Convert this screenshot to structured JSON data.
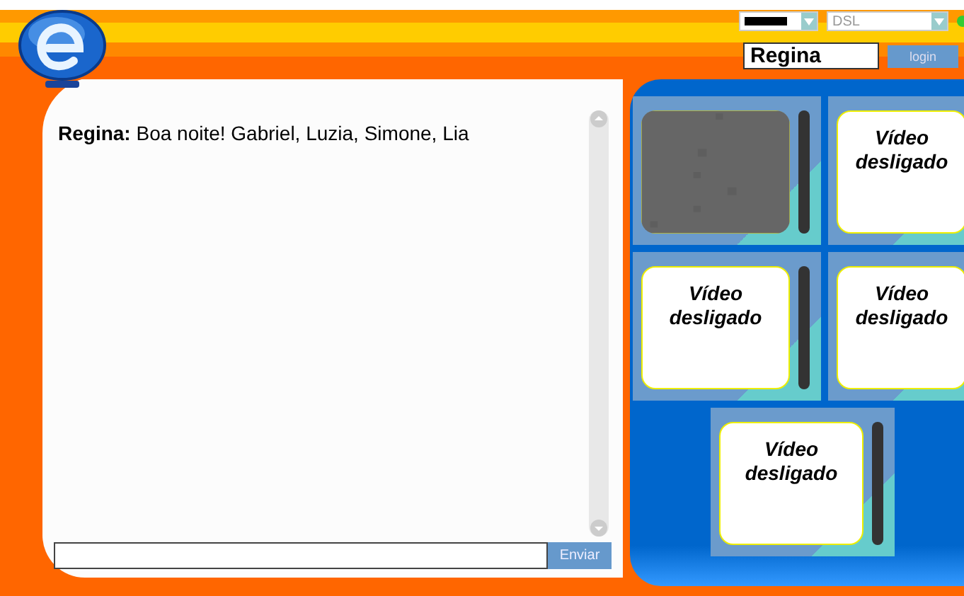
{
  "header": {
    "connection_select": {
      "value": "DSL"
    },
    "name_field": {
      "value": "Regina"
    },
    "login_button": "login"
  },
  "chat": {
    "messages": [
      {
        "author": "Regina:",
        "text": "Boa noite! Gabriel, Luzia, Simone, Lia"
      }
    ],
    "send_button": "Enviar"
  },
  "videos": [
    {
      "kind": "live"
    },
    {
      "kind": "off",
      "label": "Vídeo desligado"
    },
    {
      "kind": "off",
      "label": "Vídeo desligado"
    },
    {
      "kind": "off",
      "label": "Vídeo desligado"
    },
    {
      "kind": "off",
      "label": "Vídeo desligado"
    }
  ]
}
